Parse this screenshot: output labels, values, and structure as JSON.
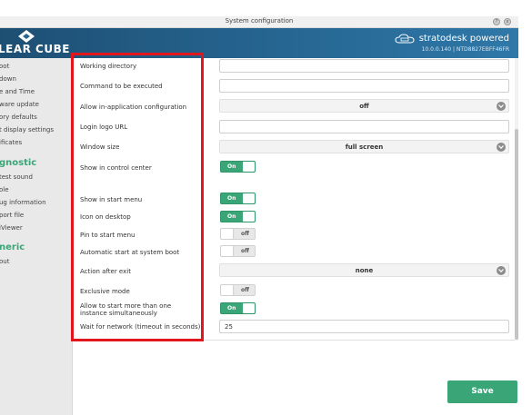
{
  "window": {
    "title": "System configuration",
    "controls": [
      "?",
      "x"
    ]
  },
  "banner": {
    "logo_text": "LEAR CUBE",
    "brand": "stratodesk powered",
    "version": "10.0.0.140 | NTD8827EBFF46FR"
  },
  "sidebar": {
    "items_top": [
      "oot",
      "down",
      "e and Time",
      "ware update",
      "ory defaults",
      "t display settings",
      "ificates"
    ],
    "heading_diag": "gnostic",
    "items_diag": [
      "test sound",
      "ole",
      "ug information",
      "port file",
      "iViewer"
    ],
    "heading_generic": "neric",
    "items_generic": [
      "out"
    ]
  },
  "form": {
    "working_dir_label": "Working directory",
    "working_dir_value": "",
    "command_label": "Command to be executed",
    "command_value": "",
    "allow_inapp_label": "Allow in-application configuration",
    "allow_inapp_value": "off",
    "login_logo_label": "Login logo URL",
    "login_logo_value": "",
    "window_size_label": "Window size",
    "window_size_value": "full screen",
    "show_cc_label": "Show in control center",
    "show_cc_state": "On",
    "show_start_label": "Show in start menu",
    "show_start_state": "On",
    "icon_desktop_label": "Icon on desktop",
    "icon_desktop_state": "On",
    "pin_start_label": "Pin to start menu",
    "pin_start_state": "off",
    "autostart_label": "Automatic start at system boot",
    "autostart_state": "off",
    "action_exit_label": "Action after exit",
    "action_exit_value": "none",
    "exclusive_label": "Exclusive mode",
    "exclusive_state": "off",
    "allow_multi_label": "Allow to start more than one instance simultaneously",
    "allow_multi_state": "On",
    "wait_network_label": "Wait for network (timeout in seconds)",
    "wait_network_value": "25"
  },
  "save_label": "Save",
  "colors": {
    "accent": "#3aa577",
    "highlight": "#e2171d",
    "banner": "#266692"
  }
}
